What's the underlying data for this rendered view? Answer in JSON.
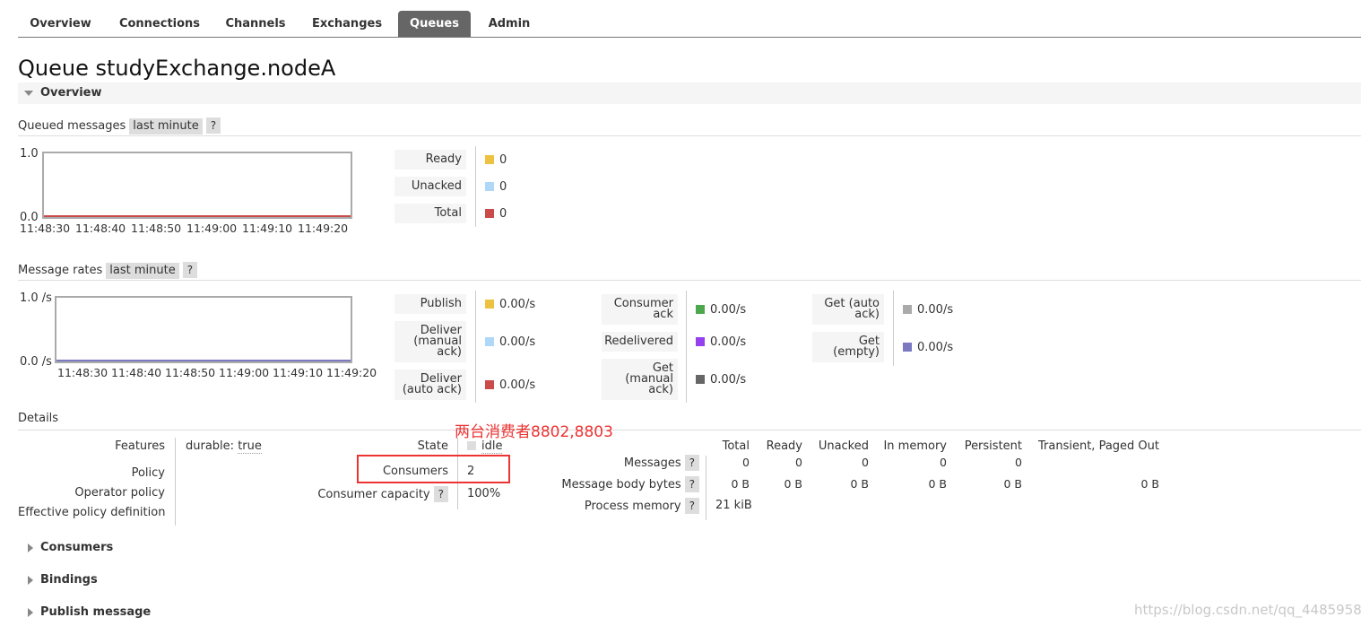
{
  "nav": {
    "tabs": [
      {
        "label": "Overview",
        "active": false
      },
      {
        "label": "Connections",
        "active": false
      },
      {
        "label": "Channels",
        "active": false
      },
      {
        "label": "Exchanges",
        "active": false
      },
      {
        "label": "Queues",
        "active": true
      },
      {
        "label": "Admin",
        "active": false
      }
    ]
  },
  "page": {
    "title_prefix": "Queue",
    "queue_name": "studyExchange.nodeA",
    "section_overview": "Overview"
  },
  "queued_messages": {
    "label": "Queued messages",
    "range": "last minute",
    "help": "?",
    "y_top": "1.0",
    "y_bottom": "0.0",
    "x_ticks": [
      "11:48:30",
      "11:48:40",
      "11:48:50",
      "11:49:00",
      "11:49:10",
      "11:49:20"
    ],
    "legend": [
      {
        "label": "Ready",
        "color": "#edc240",
        "value": "0"
      },
      {
        "label": "Unacked",
        "color": "#afd8f8",
        "value": "0"
      },
      {
        "label": "Total",
        "color": "#cb4b4b",
        "value": "0"
      }
    ]
  },
  "message_rates": {
    "label": "Message rates",
    "range": "last minute",
    "help": "?",
    "y_top": "1.0 /s",
    "y_bottom": "0.0 /s",
    "x_ticks": [
      "11:48:30",
      "11:48:40",
      "11:48:50",
      "11:49:00",
      "11:49:10",
      "11:49:20"
    ],
    "col1": [
      {
        "label": "Publish",
        "color": "#edc240",
        "value": "0.00/s"
      },
      {
        "label": "Deliver (manual ack)",
        "color": "#afd8f8",
        "value": "0.00/s"
      },
      {
        "label": "Deliver (auto ack)",
        "color": "#cb4b4b",
        "value": "0.00/s"
      }
    ],
    "col2": [
      {
        "label": "Consumer ack",
        "color": "#4da74d",
        "value": "0.00/s"
      },
      {
        "label": "Redelivered",
        "color": "#9440ed",
        "value": "0.00/s"
      },
      {
        "label": "Get (manual ack)",
        "color": "#666666",
        "value": "0.00/s"
      }
    ],
    "col3": [
      {
        "label": "Get (auto ack)",
        "color": "#aaaaaa",
        "value": "0.00/s"
      },
      {
        "label": "Get (empty)",
        "color": "#7c79c3",
        "value": "0.00/s"
      }
    ]
  },
  "details": {
    "label": "Details",
    "features_label": "Features",
    "features_key": "durable:",
    "features_value": "true",
    "policy_label": "Policy",
    "operator_policy_label": "Operator policy",
    "effective_policy_label": "Effective policy definition",
    "state_label": "State",
    "state_value": "idle",
    "consumers_label": "Consumers",
    "consumers_value": "2",
    "consumer_capacity_label": "Consumer capacity",
    "consumer_capacity_help": "?",
    "consumer_capacity_value": "100%",
    "table": {
      "headers": [
        "Total",
        "Ready",
        "Unacked",
        "In memory",
        "Persistent",
        "Transient, Paged Out"
      ],
      "rows": [
        {
          "label": "Messages",
          "help": "?",
          "values": [
            "0",
            "0",
            "0",
            "0",
            "0",
            ""
          ]
        },
        {
          "label": "Message body bytes",
          "help": "?",
          "values": [
            "0 B",
            "0 B",
            "0 B",
            "0 B",
            "0 B",
            "0 B"
          ]
        },
        {
          "label": "Process memory",
          "help": "?",
          "values": [
            "21 kiB",
            "",
            "",
            "",
            "",
            ""
          ]
        }
      ]
    }
  },
  "annotation": {
    "text": "两台消费者8802,8803",
    "color": "#e33333"
  },
  "collapsed_sections": [
    "Consumers",
    "Bindings",
    "Publish message"
  ],
  "watermark": "https://blog.csdn.net/qq_44859586"
}
